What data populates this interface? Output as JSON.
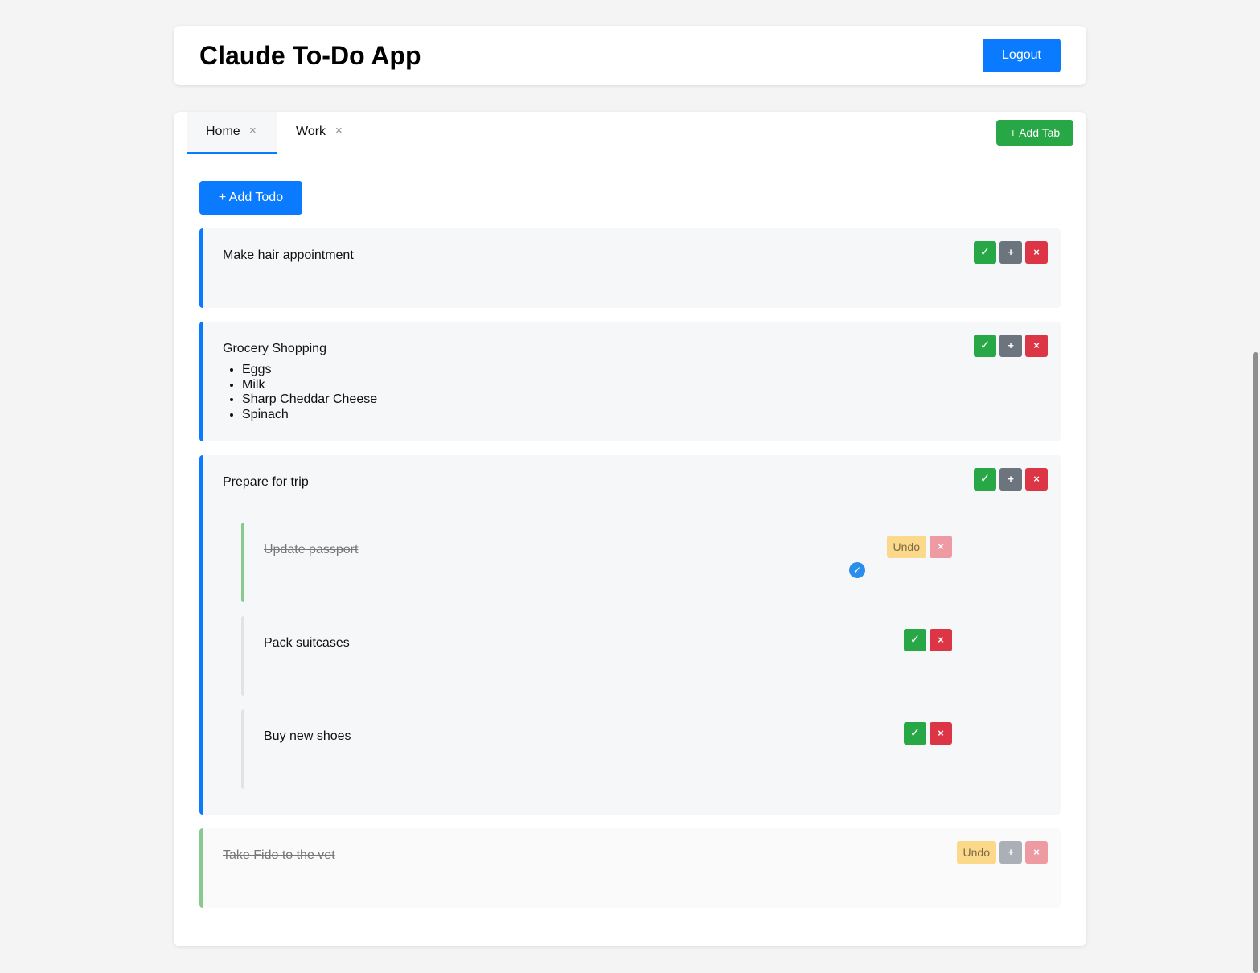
{
  "header": {
    "title": "Claude To-Do App",
    "logout_label": "Logout"
  },
  "tabs": [
    {
      "label": "Home",
      "close": "×",
      "active": true
    },
    {
      "label": "Work",
      "close": "×",
      "active": false
    }
  ],
  "add_tab_label": "+ Add Tab",
  "add_todo_label": "+ Add Todo",
  "icons": {
    "check": "✓",
    "plus": "+",
    "close": "×",
    "checkmark_circle": "✓"
  },
  "undo_label": "Undo",
  "todos": [
    {
      "text": "Make hair appointment",
      "completed": false
    },
    {
      "text": "Grocery Shopping",
      "completed": false,
      "items": [
        "Eggs",
        "Milk",
        "Sharp Cheddar Cheese",
        "Spinach"
      ]
    },
    {
      "text": "Prepare for trip",
      "completed": false,
      "subtodos": [
        {
          "text": "Update passport",
          "completed": true
        },
        {
          "text": "Pack suitcases",
          "completed": false
        },
        {
          "text": "Buy new shoes",
          "completed": false
        }
      ]
    },
    {
      "text": "Take Fido to the vet",
      "completed": true
    }
  ],
  "colors": {
    "primary": "#0a7bff",
    "success": "#27a745",
    "secondary": "#6c757d",
    "danger": "#dc3545",
    "warning": "#fbd88a"
  }
}
